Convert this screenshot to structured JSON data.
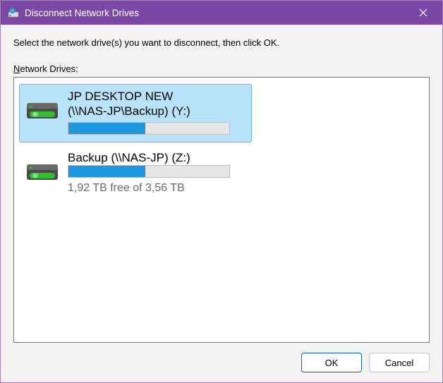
{
  "window": {
    "title": "Disconnect Network Drives"
  },
  "content": {
    "instruction": "Select the network drive(s) you want to disconnect, then click OK.",
    "list_label_prefix": "N",
    "list_label_rest": "etwork Drives:"
  },
  "drives": [
    {
      "line1": "JP DESKTOP NEW",
      "line2": "(\\\\NAS-JP\\Backup) (Y:)",
      "usage_percent": 48,
      "free_text": "",
      "selected": true
    },
    {
      "line1": "Backup (\\\\NAS-JP) (Z:)",
      "line2": "",
      "usage_percent": 48,
      "free_text": "1,92 TB free of 3,56 TB",
      "selected": false
    }
  ],
  "buttons": {
    "ok": "OK",
    "cancel": "Cancel"
  }
}
